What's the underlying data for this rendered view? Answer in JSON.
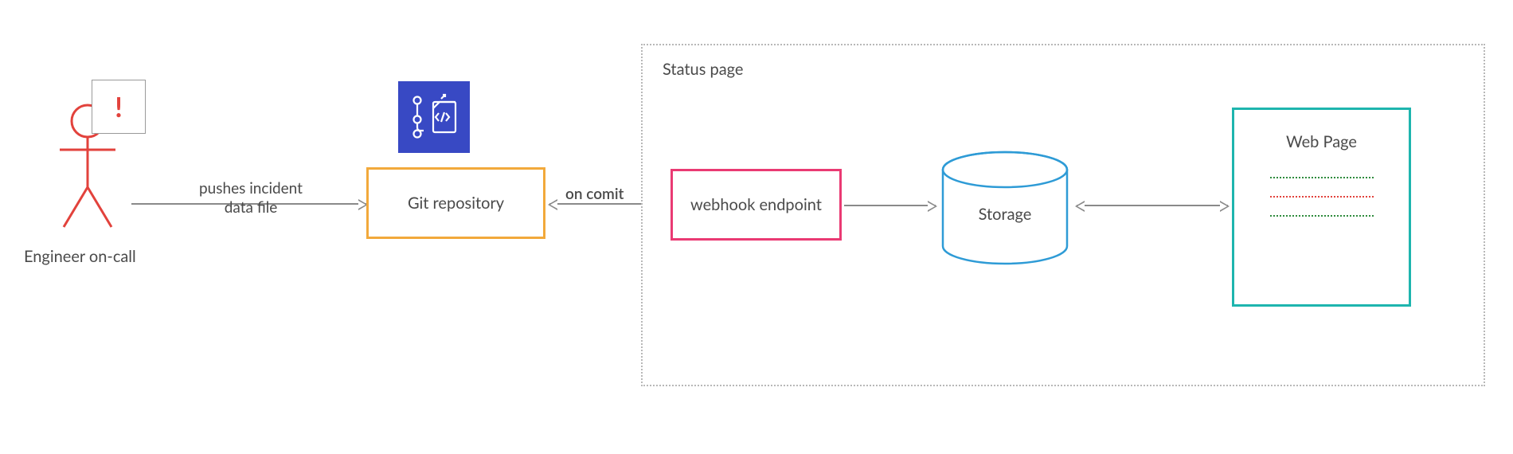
{
  "actor": {
    "label": "Engineer on-call",
    "alert_symbol": "!"
  },
  "connectors": {
    "push": {
      "label": "pushes incident\ndata file"
    },
    "commit": {
      "label": "on comit"
    }
  },
  "git": {
    "label": "Git repository",
    "icon_name": "codecommit-icon"
  },
  "status_page": {
    "title": "Status page",
    "webhook_label": "webhook endpoint",
    "storage_label": "Storage",
    "webpage": {
      "title": "Web Page",
      "lines": [
        "green",
        "red",
        "green"
      ]
    }
  },
  "colors": {
    "actor_stroke": "#E2423C",
    "git_border": "#F2A93B",
    "git_icon_bg": "#3849C4",
    "webhook_border": "#EA3A73",
    "storage_stroke": "#2E9BD6",
    "webpage_border": "#1EB5AE",
    "connector": "#8a8a8a"
  }
}
